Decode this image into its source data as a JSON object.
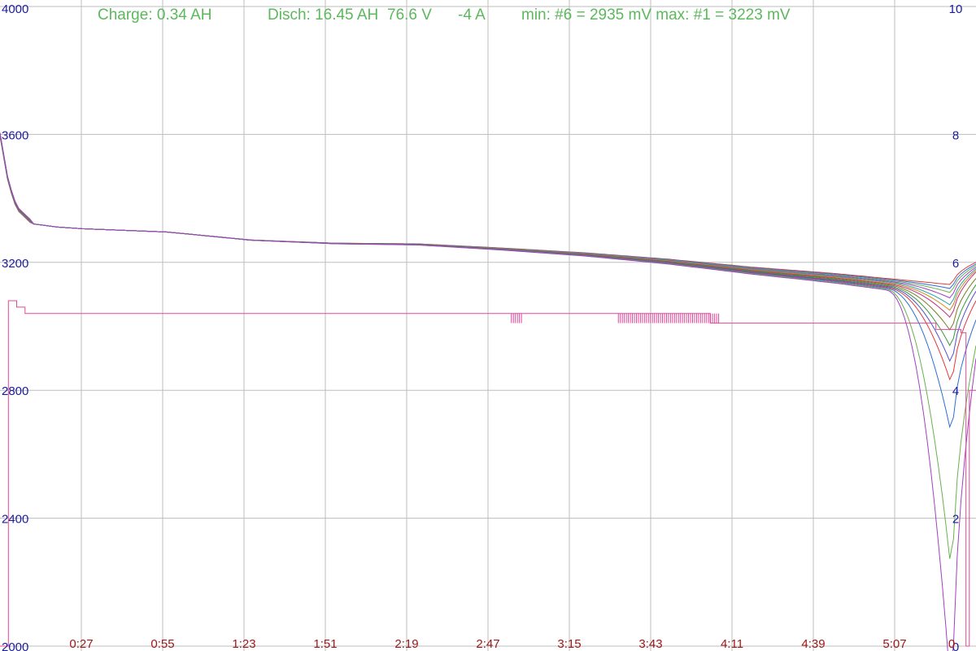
{
  "status": {
    "charge": "Charge: 0.34 AH",
    "disch": "Disch: 16.45 AH",
    "voltage": "76.6 V",
    "current": "-4 A",
    "minmax": "min: #6 = 2935 mV max: #1 = 3223 mV"
  },
  "colors": {
    "grid": "#bdbdbd",
    "status_text": "#5cb85c",
    "left_tick": "#1a1a9c",
    "x_tick": "#a01818",
    "current_line": "#e0489a",
    "series_palette": [
      "#e03a3a",
      "#2a6fd6",
      "#6ab04c",
      "#a040c0",
      "#2aa0a0",
      "#d08a20",
      "#c03080",
      "#7a7a20",
      "#3a9a3a",
      "#5050d0"
    ]
  },
  "chart_data": {
    "type": "line",
    "title": "",
    "xlabel": "",
    "ylabel": "",
    "y_left": {
      "range": [
        2000,
        4000
      ],
      "ticks": [
        "4000",
        "3600",
        "3200",
        "2800",
        "2400",
        "2000"
      ]
    },
    "y_right": {
      "range": [
        0,
        10
      ],
      "ticks": [
        "10",
        "8",
        "6",
        "4",
        "2",
        "0"
      ]
    },
    "x_ticks": [
      "0:27",
      "0:55",
      "1:23",
      "1:51",
      "2:19",
      "2:47",
      "3:15",
      "3:43",
      "4:11",
      "4:39",
      "5:07",
      "0"
    ],
    "grid": true,
    "x_range": [
      0,
      5.84
    ],
    "cell_voltage_series": {
      "description": "cell voltages (mV), approximate shared shape; spread near end",
      "x": [
        0,
        0.05,
        0.1,
        0.2,
        0.35,
        0.5,
        1.0,
        1.5,
        2.0,
        2.5,
        3.0,
        3.5,
        4.0,
        4.5,
        5.0,
        5.3,
        5.5,
        5.6,
        5.7,
        5.8,
        5.84
      ],
      "base": [
        3600,
        3450,
        3370,
        3320,
        3310,
        3305,
        3295,
        3270,
        3260,
        3258,
        3245,
        3230,
        3210,
        3185,
        3165,
        3150,
        3140,
        3135,
        3130,
        3200,
        3220
      ],
      "dip_depth": [
        0,
        10,
        20,
        35,
        55,
        70,
        90,
        130,
        180,
        230,
        290,
        450,
        900,
        1300
      ],
      "end_recover": [
        3200,
        3195,
        3190,
        3185,
        3180,
        3175,
        3170,
        3150,
        3130,
        3110,
        3080,
        3020,
        2940,
        2900
      ]
    },
    "current_series": {
      "name": "",
      "description": "current (A, right axis), mostly flat ~5.2 dropping near end",
      "x": [
        0,
        0.05,
        0.1,
        0.15,
        0.2,
        4.2,
        4.25,
        5.5,
        5.6,
        5.75,
        5.78,
        5.8,
        5.84
      ],
      "y": [
        0.0,
        5.4,
        5.3,
        5.2,
        5.2,
        5.2,
        5.05,
        5.05,
        4.95,
        4.9,
        0.0,
        4.0,
        4.0
      ]
    }
  }
}
